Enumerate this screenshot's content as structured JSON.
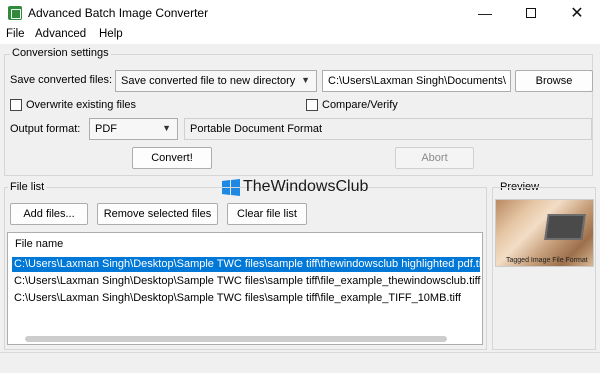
{
  "window": {
    "title": "Advanced Batch Image Converter"
  },
  "menu": {
    "items": [
      {
        "label": "File"
      },
      {
        "label": "Advanced"
      },
      {
        "label": "Help"
      }
    ]
  },
  "conversion": {
    "group_title": "Conversion settings",
    "save_label": "Save converted files:",
    "save_mode": "Save converted file to new directory",
    "directory": "C:\\Users\\Laxman Singh\\Documents\\",
    "browse_label": "Browse",
    "overwrite_label": "Overwrite existing files",
    "compare_label": "Compare/Verify",
    "output_label": "Output format:",
    "format": "PDF",
    "format_desc": "Portable Document Format",
    "convert_label": "Convert!",
    "abort_label": "Abort"
  },
  "filelist": {
    "group_title": "File list",
    "add_label": "Add files...",
    "remove_label": "Remove selected files",
    "clear_label": "Clear file list",
    "column_header": "File name",
    "files": [
      "C:\\Users\\Laxman Singh\\Desktop\\Sample TWC files\\sample tiff\\thewindowsclub highlighted pdf.tiff",
      "C:\\Users\\Laxman Singh\\Desktop\\Sample TWC files\\sample tiff\\file_example_thewindowsclub.tiff",
      "C:\\Users\\Laxman Singh\\Desktop\\Sample TWC files\\sample tiff\\file_example_TIFF_10MB.tiff"
    ]
  },
  "preview": {
    "title": "Preview",
    "caption": "Tagged Image File Format"
  },
  "watermark": {
    "text": "TheWindowsClub"
  }
}
